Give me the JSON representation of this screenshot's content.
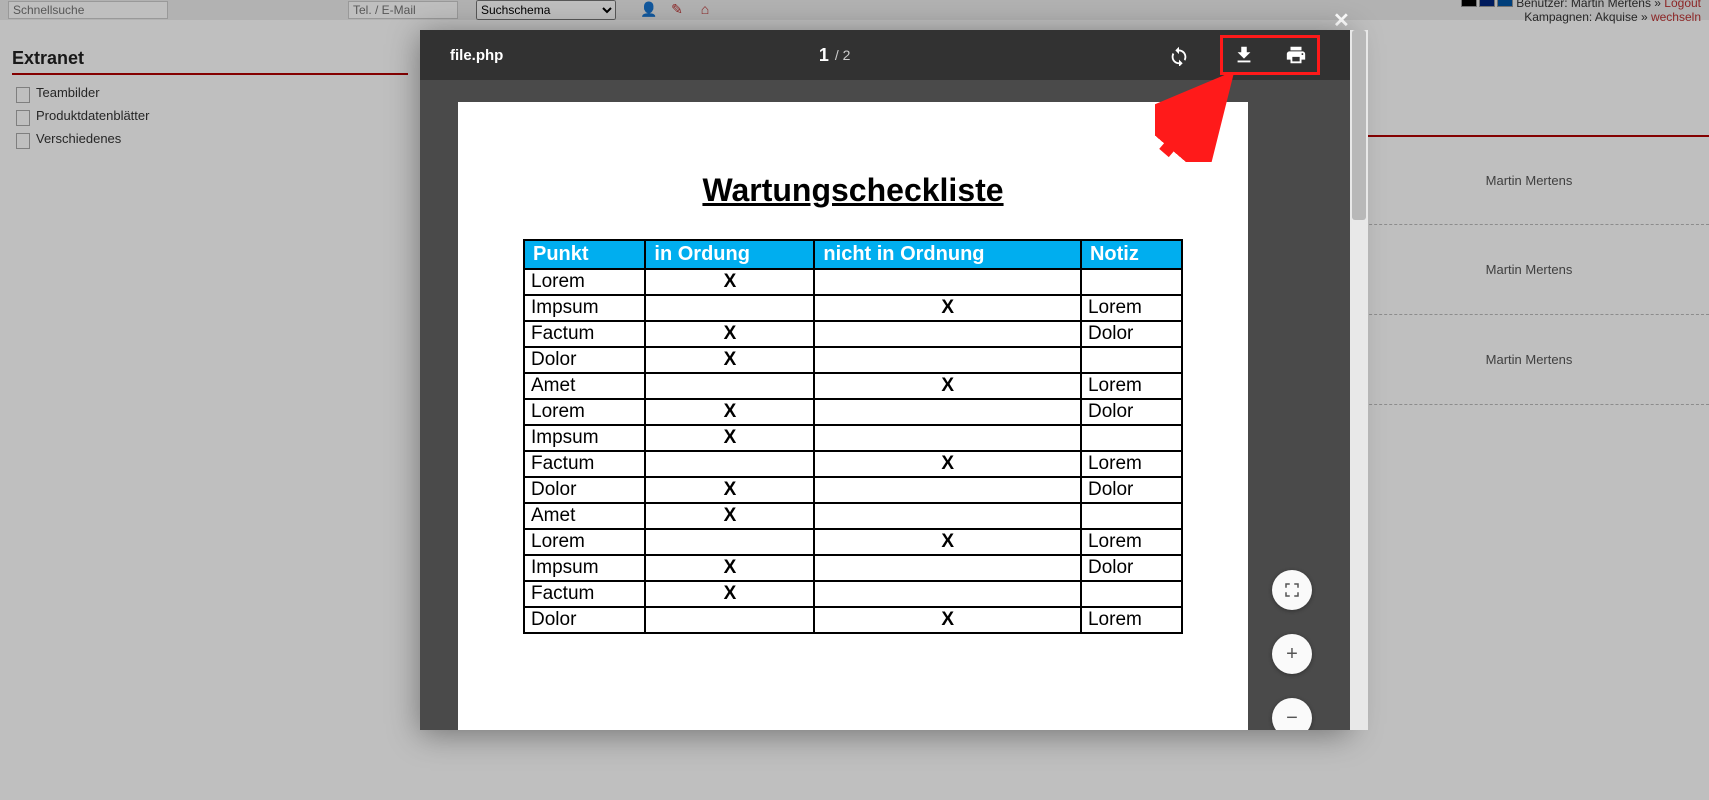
{
  "topbar": {
    "quick_placeholder": "Schnellsuche",
    "tel_placeholder": "Tel. / E-Mail",
    "select_label": "Suchschema",
    "user_label": "Benutzer:",
    "user_name": "Martin Mertens",
    "logout": "Logout",
    "camp_label": "Kampagnen:",
    "camp_name": "Akquise",
    "wechseln": "wechseln"
  },
  "sidebar": {
    "title": "Extranet",
    "items": [
      "Teambilder",
      "Produktdatenblätter",
      "Verschiedenes"
    ]
  },
  "rightlist": {
    "name": "Martin Mertens"
  },
  "viewer": {
    "filename": "file.php",
    "page_cur": "1",
    "page_total": "/ 2",
    "doc_title": "Wartungscheckliste",
    "headers": [
      "Punkt",
      "in Ordung",
      "nicht in Ordnung",
      "Notiz"
    ],
    "rows": [
      {
        "p": "Lorem",
        "ok": "X",
        "nok": "",
        "n": ""
      },
      {
        "p": "Impsum",
        "ok": "",
        "nok": "X",
        "n": "Lorem"
      },
      {
        "p": "Factum",
        "ok": "X",
        "nok": "",
        "n": "Dolor"
      },
      {
        "p": "Dolor",
        "ok": "X",
        "nok": "",
        "n": ""
      },
      {
        "p": "Amet",
        "ok": "",
        "nok": "X",
        "n": "Lorem"
      },
      {
        "p": "Lorem",
        "ok": "X",
        "nok": "",
        "n": "Dolor"
      },
      {
        "p": "Impsum",
        "ok": "X",
        "nok": "",
        "n": ""
      },
      {
        "p": "Factum",
        "ok": "",
        "nok": "X",
        "n": "Lorem"
      },
      {
        "p": "Dolor",
        "ok": "X",
        "nok": "",
        "n": "Dolor"
      },
      {
        "p": "Amet",
        "ok": "X",
        "nok": "",
        "n": ""
      },
      {
        "p": "Lorem",
        "ok": "",
        "nok": "X",
        "n": "Lorem"
      },
      {
        "p": "Impsum",
        "ok": "X",
        "nok": "",
        "n": "Dolor"
      },
      {
        "p": "Factum",
        "ok": "X",
        "nok": "",
        "n": ""
      },
      {
        "p": "Dolor",
        "ok": "",
        "nok": "X",
        "n": "Lorem"
      }
    ]
  },
  "zoom": {
    "fit": "⛶",
    "plus": "+",
    "minus": "−"
  }
}
